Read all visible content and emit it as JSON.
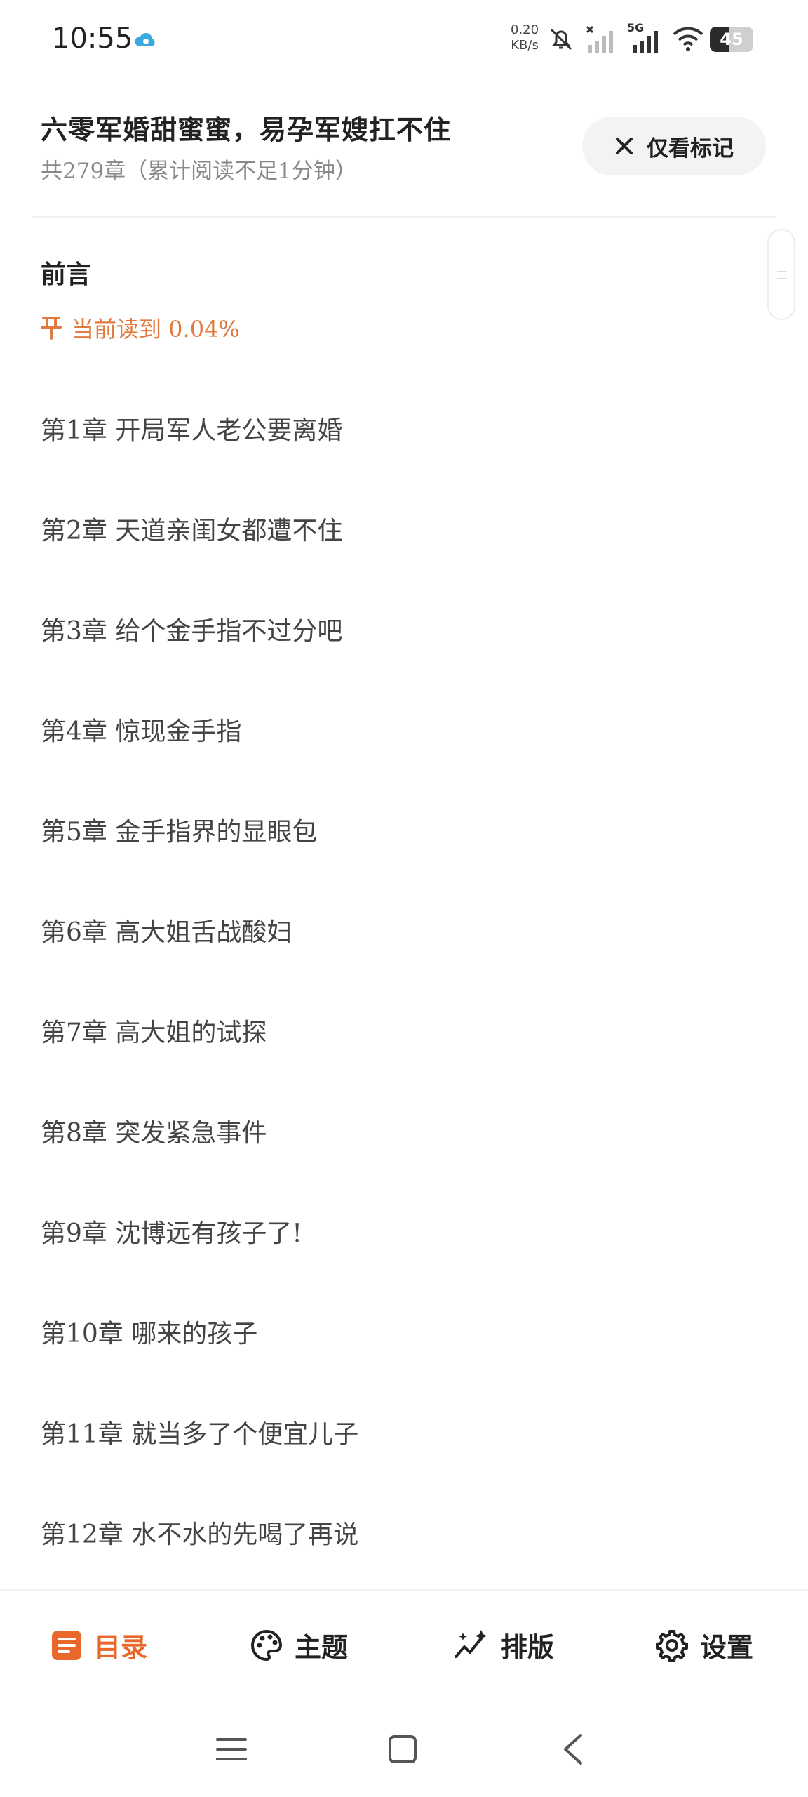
{
  "status_bar": {
    "time": "10:55",
    "speed_value": "0.20",
    "speed_unit": "KB/s",
    "network": "5G",
    "battery": "45",
    "battery_level": 0.45
  },
  "header": {
    "title": "六零军婚甜蜜蜜，易孕军嫂扛不住",
    "subtitle": "共279章（累计阅读不足1分钟）",
    "mark_button": "仅看标记"
  },
  "toc": {
    "preface": "前言",
    "progress_text": "当前读到 0.04%",
    "chapters": [
      "第1章 开局军人老公要离婚",
      "第2章 天道亲闺女都遭不住",
      "第3章 给个金手指不过分吧",
      "第4章 惊现金手指",
      "第5章 金手指界的显眼包",
      "第6章 高大姐舌战酸妇",
      "第7章 高大姐的试探",
      "第8章 突发紧急事件",
      "第9章 沈博远有孩子了!",
      "第10章 哪来的孩子",
      "第11章 就当多了个便宜儿子",
      "第12章 水不水的先喝了再说"
    ]
  },
  "tabs": [
    {
      "label": "目录",
      "icon": "list-icon",
      "active": true
    },
    {
      "label": "主题",
      "icon": "palette-icon",
      "active": false
    },
    {
      "label": "排版",
      "icon": "sparkle-icon",
      "active": false
    },
    {
      "label": "设置",
      "icon": "gear-icon",
      "active": false
    }
  ],
  "colors": {
    "accent": "#e9672b",
    "progress": "#e07b3f",
    "text": "#444444",
    "button_bg": "#f2f3f5"
  }
}
